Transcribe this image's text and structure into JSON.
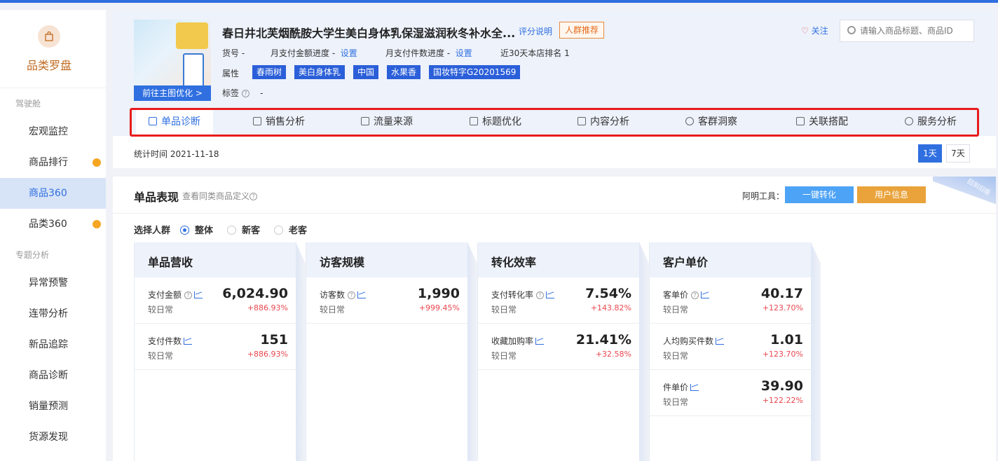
{
  "sidebar": {
    "logo_title": "品类罗盘",
    "group1": "驾驶舱",
    "group2": "专题分析",
    "items": [
      {
        "label": "宏观监控"
      },
      {
        "label": "商品排行"
      },
      {
        "label": "商品360"
      },
      {
        "label": "品类360"
      },
      {
        "label": "异常预警"
      },
      {
        "label": "连带分析"
      },
      {
        "label": "新品追踪"
      },
      {
        "label": "商品诊断"
      },
      {
        "label": "销量预测"
      },
      {
        "label": "货源发现"
      }
    ]
  },
  "product": {
    "title": "春日井北芙烟酰胺大学生美白身体乳保湿滋润秋冬补水全...",
    "rating_link": "评分说明",
    "recommend_btn": "人群推荐",
    "thumb_btn": "前往主图优化 >",
    "item_no_label": "货号 -",
    "monthly_amount_label": "月支付金额进度 -",
    "monthly_amount_link": "设置",
    "monthly_count_label": "月支付件数进度 -",
    "monthly_count_link": "设置",
    "rank_label": "近30天本店排名 1",
    "attr_label": "属性",
    "tags": [
      "春雨树",
      "美白身体乳",
      "中国",
      "水果香",
      "国妆特字G20201569"
    ],
    "tag_label": "标签",
    "tag_value": "-"
  },
  "header": {
    "follow": "关注",
    "search_placeholder": "请输入商品标题、商品ID"
  },
  "tabs": [
    {
      "label": "单品诊断"
    },
    {
      "label": "销售分析"
    },
    {
      "label": "流量来源"
    },
    {
      "label": "标题优化"
    },
    {
      "label": "内容分析"
    },
    {
      "label": "客群洞察"
    },
    {
      "label": "关联搭配"
    },
    {
      "label": "服务分析"
    }
  ],
  "stat_time": "统计时间 2021-11-18",
  "day_buttons": [
    "1天",
    "7天"
  ],
  "section": {
    "title": "单品表现",
    "subtitle": "查看同类商品定义",
    "tools_label": "阿明工具：",
    "tool1": "一键转化",
    "tool2": "用户信息",
    "corner": "回到旧版",
    "crowd_label": "选择人群",
    "crowd_options": [
      "整体",
      "新客",
      "老客"
    ]
  },
  "cards": [
    {
      "title": "单品营收",
      "rows": [
        {
          "label": "支付金额",
          "sub": "较日常",
          "value": "6,024.90",
          "change": "+886.93%"
        },
        {
          "label": "支付件数",
          "sub": "较日常",
          "value": "151",
          "change": "+886.93%"
        }
      ]
    },
    {
      "title": "访客规模",
      "rows": [
        {
          "label": "访客数",
          "sub": "较日常",
          "value": "1,990",
          "change": "+999.45%"
        }
      ]
    },
    {
      "title": "转化效率",
      "rows": [
        {
          "label": "支付转化率",
          "sub": "较日常",
          "value": "7.54%",
          "change": "+143.82%"
        },
        {
          "label": "收藏加购率",
          "sub": "较日常",
          "value": "21.41%",
          "change": "+32.58%"
        }
      ]
    },
    {
      "title": "客户单价",
      "rows": [
        {
          "label": "客单价",
          "sub": "较日常",
          "value": "40.17",
          "change": "+123.70%"
        },
        {
          "label": "人均购买件数",
          "sub": "较日常",
          "value": "1.01",
          "change": "+123.70%"
        },
        {
          "label": "件单价",
          "sub": "较日常",
          "value": "39.90",
          "change": "+122.22%"
        }
      ]
    }
  ],
  "colors": {
    "accent": "#2f6fe0",
    "highlight": "#e81c1c",
    "tool1": "#4da3f5",
    "tool2": "#e9a33a",
    "up": "#e9474f"
  }
}
